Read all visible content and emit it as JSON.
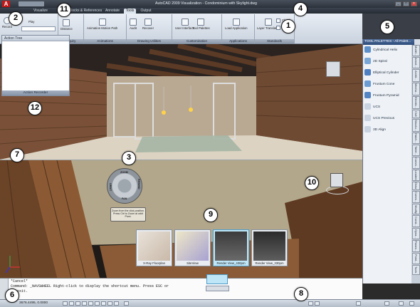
{
  "window": {
    "title": "AutoCAD 2009 Visualization - Condominium with Skylight.dwg",
    "app_logo": "A"
  },
  "ribbon": {
    "tabs": [
      {
        "label": "Visualize"
      },
      {
        "label": "Blocks & References"
      },
      {
        "label": "Annotate"
      },
      {
        "label": "Tools"
      },
      {
        "label": "Output"
      }
    ],
    "active_tab_index": 3,
    "groups": {
      "inquiry": {
        "title": "Inquiry",
        "distance_label": "Distance"
      },
      "animations": {
        "title": "Animations",
        "motion_path_label": "Animation Motion Path"
      },
      "drawing_utilities": {
        "title": "Drawing Utilities",
        "audit_label": "Audit",
        "recover_label": "Recover"
      },
      "customization": {
        "title": "Customization",
        "user_interface_label": "User Interface",
        "tool_palettes_label": "Tool Palettes"
      },
      "applications": {
        "title": "Applications",
        "load_application_label": "Load Application"
      },
      "standards": {
        "title": "Standards",
        "layer_translator_label": "Layer Translator",
        "check_label": "Check",
        "configure_label": "Configure"
      }
    },
    "left_labels": {
      "record_label": "Record",
      "play_label": "Play"
    }
  },
  "action_tree": {
    "header": "Action Tree",
    "footer": "Action Recorder"
  },
  "tool_palette": {
    "header": "TOOL PALETTES - All Palett...",
    "items": [
      {
        "label": "Cylindrical Helix",
        "icon": "helix-icon"
      },
      {
        "label": "2D Spiral",
        "icon": "spiral-icon"
      },
      {
        "label": "Elliptical Cylinder",
        "icon": "cylinder-icon"
      },
      {
        "label": "Frustum Cone",
        "icon": "cone-icon"
      },
      {
        "label": "Frustum Pyramid",
        "icon": "pyramid-icon"
      },
      {
        "label": "UCS",
        "icon": "ucs-icon"
      },
      {
        "label": "UCS Previous",
        "icon": "ucs-previous-icon"
      },
      {
        "label": "3D Align",
        "icon": "align-icon"
      }
    ],
    "tabs": [
      "Model...",
      "Annot...",
      "Archit...",
      "Mecha...",
      "Electric...",
      "Civil",
      "Structu...",
      "Hatch...",
      "Table...",
      "Comm...",
      "Leaders",
      "Draw",
      "Comm...",
      "Modify",
      "Const...",
      "Dyna...",
      "Param...",
      "Point...",
      "Tools"
    ]
  },
  "navigation_wheel": {
    "labels": [
      "ZOOM",
      "ORBIT",
      "PAN",
      "REWIND"
    ],
    "tooltip": "Zoom from the click position. Press Ctrl to Zoom at orbit Pivot."
  },
  "show_motion": {
    "thumbnails": [
      {
        "label": "X-Ray Floorplan",
        "selected": false
      },
      {
        "label": "SiteView",
        "selected": false
      },
      {
        "label": "Render View_430pm",
        "selected": true
      },
      {
        "label": "Render View_330pm",
        "selected": false
      }
    ]
  },
  "command_line": {
    "lines": [
      "*Cancel*",
      "Command: _NAVSWHEEL Right-click to display the shortcut menu. Press ESC or",
      "to exit."
    ]
  },
  "status_bar": {
    "coordinates": "3676.4495, 0.0000"
  },
  "callouts": [
    "1",
    "2",
    "3",
    "4",
    "5",
    "6",
    "7",
    "8",
    "9",
    "10",
    "11",
    "12"
  ]
}
